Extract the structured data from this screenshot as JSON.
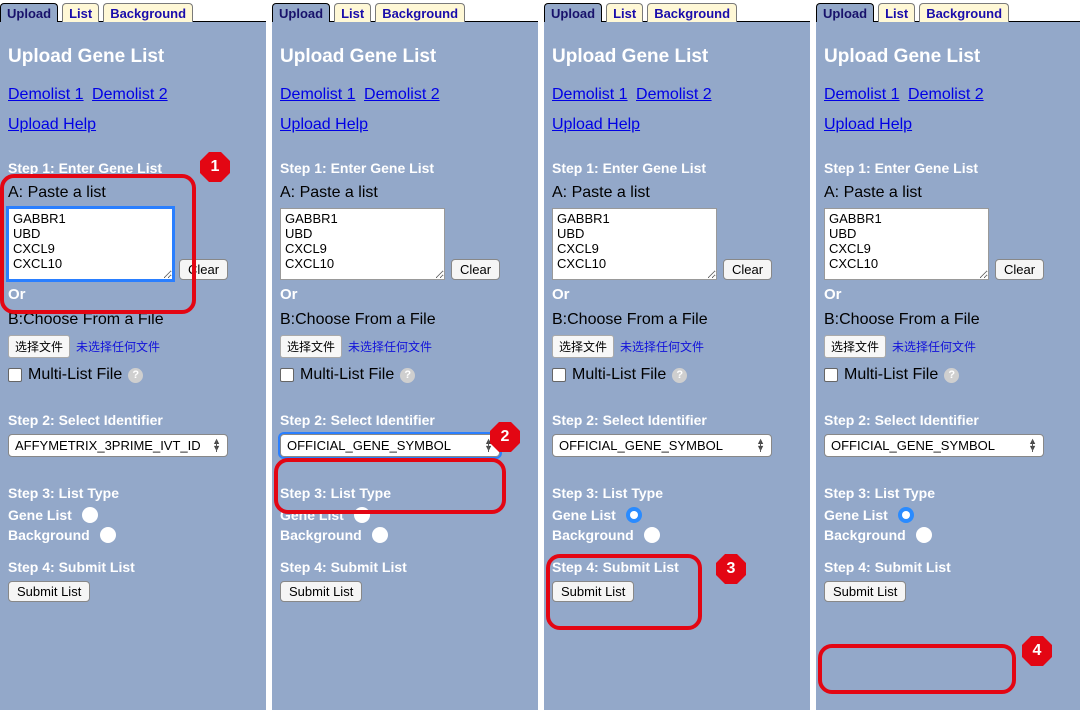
{
  "tabs": {
    "upload": "Upload",
    "list": "List",
    "background": "Background"
  },
  "title": "Upload Gene List",
  "links": {
    "demo1": "Demolist 1",
    "demo2": "Demolist 2",
    "help": "Upload Help"
  },
  "step1": {
    "label": "Step 1: Enter Gene List",
    "paste_label": "A: Paste a list",
    "textarea": "GABBR1\nUBD\nCXCL9\nCXCL10",
    "clear": "Clear",
    "or": "Or",
    "choose_label": "B:Choose From a File",
    "file_btn": "选择文件",
    "file_status": "未选择任何文件",
    "multi": "Multi-List File",
    "help_icon": "?"
  },
  "step2": {
    "label": "Step 2: Select Identifier"
  },
  "selects": {
    "affy": "AFFYMETRIX_3PRIME_IVT_ID",
    "ogs": "OFFICIAL_GENE_SYMBOL"
  },
  "step3": {
    "label": "Step 3: List Type",
    "gene": "Gene List",
    "background": "Background"
  },
  "step4": {
    "label": "Step 4: Submit List",
    "submit": "Submit List"
  },
  "badges": {
    "b1": "1",
    "b2": "2",
    "b3": "3",
    "b4": "4"
  }
}
